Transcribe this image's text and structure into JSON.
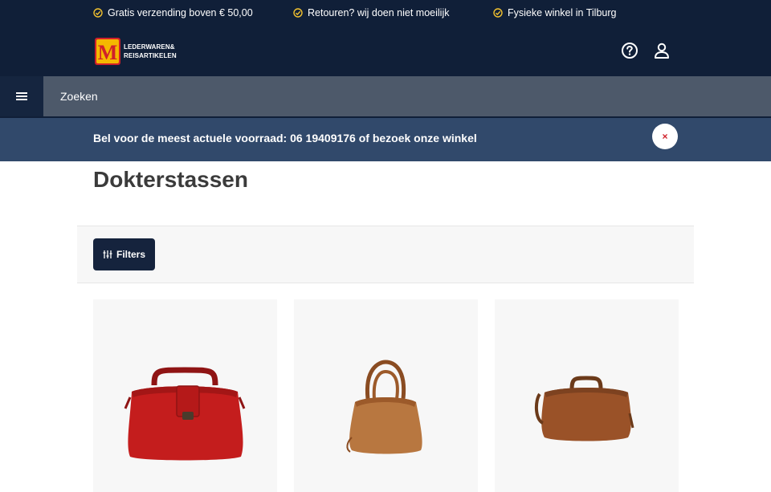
{
  "usps": [
    {
      "text": "Gratis verzending boven € 50,00",
      "icon": "check-icon"
    },
    {
      "text": "Retouren? wij doen niet moeilijk",
      "icon": "check-icon"
    },
    {
      "text": "Fysieke winkel in Tilburg",
      "icon": "check-icon"
    }
  ],
  "logo": {
    "letter": "M",
    "line1": "LEDERWAREN&",
    "line2": "REISARTIKELEN"
  },
  "header": {
    "help_icon": "help-icon",
    "account_icon": "user-icon"
  },
  "search": {
    "placeholder": "Zoeken",
    "menu_icon": "hamburger-menu-icon"
  },
  "notice": {
    "text": "Bel voor de meest actuele voorraad: 06 19409176 of bezoek onze winkel",
    "close_label": "×"
  },
  "page": {
    "title": "Dokterstassen"
  },
  "filters": {
    "label": "Filters",
    "icon": "sliders-icon"
  },
  "products": [
    {
      "image": "red-doctor-bag"
    },
    {
      "image": "tan-frame-handbag"
    },
    {
      "image": "brown-doctor-bag"
    }
  ],
  "colors": {
    "header_bg": "#101f38",
    "search_bg": "#4d596a",
    "notice_bg": "#31496b",
    "check": "#f2c12e",
    "logo_red": "#d0202a",
    "logo_yellow": "#f5b800"
  }
}
